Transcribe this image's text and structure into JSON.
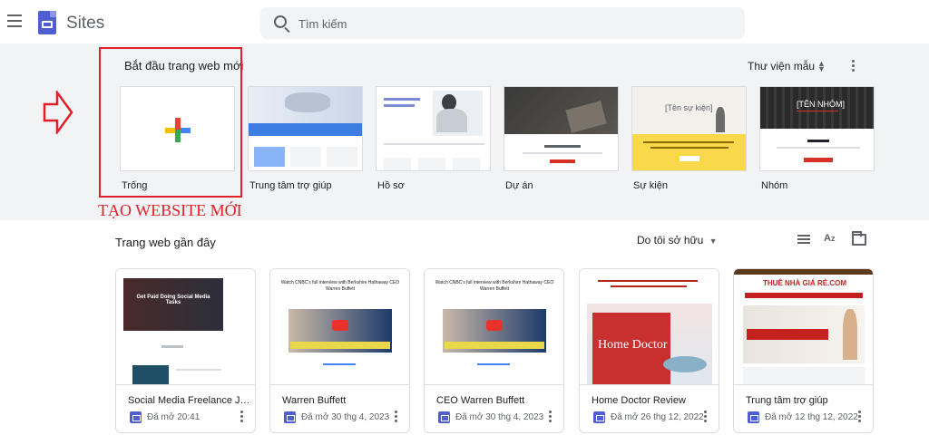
{
  "header": {
    "app_title": "Sites",
    "search_placeholder": "Tìm kiếm"
  },
  "templates": {
    "title": "Bắt đầu trang web mới",
    "gallery_label": "Thư viện mẫu",
    "items": [
      {
        "label": "Trống"
      },
      {
        "label": "Trung tâm trợ giúp"
      },
      {
        "label": "Hồ sơ"
      },
      {
        "label": "Dự án"
      },
      {
        "label": "Sự kiện"
      },
      {
        "label": "Nhóm"
      }
    ],
    "thumb_text": {
      "event_name": "[Tên sự kiện]",
      "team_name": "[TÊN NHÓM]"
    }
  },
  "annotation": {
    "label": "TẠO WEBSITE MỚI",
    "color": "#e0202a"
  },
  "recent": {
    "title": "Trang web gần đây",
    "owner_filter": "Do tôi sở hữu",
    "items": [
      {
        "name": "Social Media Freelance Jo...",
        "date": "Đã mở 20:41",
        "thumb_text": "Get Paid Doing Social Media Tasks"
      },
      {
        "name": "Warren Buffett",
        "date": "Đã mở 30 thg 4, 2023",
        "thumb_text": "Watch CNBC's full interview with Berkshire Hathaway CEO Warren Buffett"
      },
      {
        "name": "CEO Warren Buffett",
        "date": "Đã mở 30 thg 4, 2023",
        "thumb_text": "Watch CNBC's full interview with Berkshire Hathaway CEO Warren Buffett"
      },
      {
        "name": "Home Doctor Review",
        "date": "Đã mở 26 thg 12, 2022",
        "thumb_text": "Home Doctor"
      },
      {
        "name": "Trung tâm trợ giúp",
        "date": "Đã mở 12 thg 12, 2022",
        "thumb_text": "THUÊ NHÀ GIÁ RẺ.COM"
      }
    ]
  },
  "colors": {
    "accent": "#4f5fd1",
    "background_gray": "#f1f3f4",
    "plus_blue": "#4285f4",
    "plus_red": "#ea4335",
    "plus_yellow": "#fbbc04",
    "plus_green": "#34a853"
  }
}
